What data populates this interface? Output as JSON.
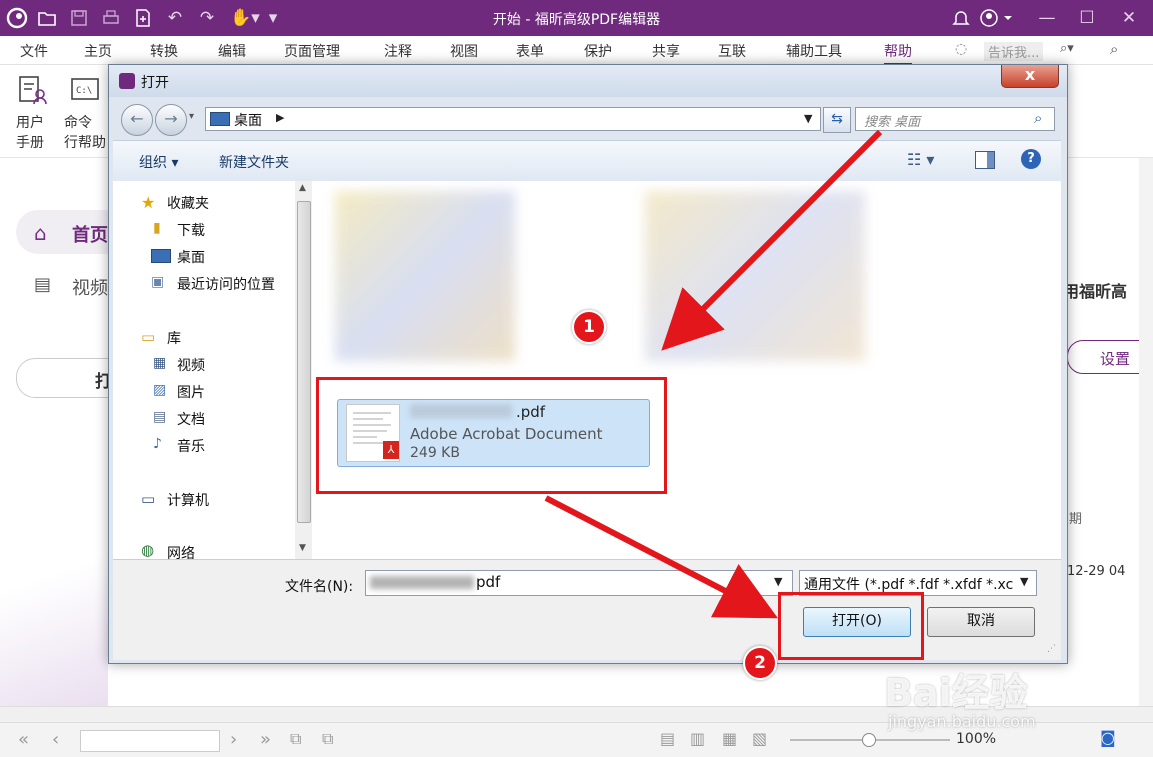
{
  "app": {
    "title": "开始 - 福昕高级PDF编辑器",
    "menus": [
      "文件",
      "主页",
      "转换",
      "编辑",
      "页面管理",
      "注释",
      "视图",
      "表单",
      "保护",
      "共享",
      "互联",
      "辅助工具",
      "帮助"
    ],
    "active_menu": "帮助",
    "search_placeholder": "告诉我...",
    "ribbon": [
      {
        "label1": "用户",
        "label2": "手册",
        "icon": "user-manual-icon"
      },
      {
        "label1": "命令",
        "label2": "行帮助",
        "icon": "command-line-icon"
      }
    ],
    "left_nav": [
      {
        "label": "首页",
        "icon": "home-icon"
      },
      {
        "label": "视频",
        "icon": "video-icon"
      }
    ],
    "left_button_partial": "打",
    "right_partial": {
      "heading": "用福昕高",
      "settings": "设置",
      "date_col": "期",
      "date_value": "12-29 04"
    },
    "zoom": "100%"
  },
  "dialog": {
    "title": "打开",
    "close": "x",
    "address": "桌面",
    "search_placeholder": "搜索 桌面",
    "organize": "组织",
    "new_folder": "新建文件夹",
    "favorites": {
      "label": "收藏夹",
      "items": [
        "下载",
        "桌面",
        "最近访问的位置"
      ]
    },
    "libraries": {
      "label": "库",
      "items": [
        "视频",
        "图片",
        "文档",
        "音乐"
      ]
    },
    "computer": "计算机",
    "network": "网络",
    "file": {
      "name": ".pdf",
      "type": "Adobe Acrobat Document",
      "size": "249 KB"
    },
    "filename_label": "文件名(N):",
    "filename_value": "pdf",
    "filetype": "通用文件 (*.pdf *.fdf *.xfdf *.xc",
    "open_button": "打开(O)",
    "cancel_button": "取消"
  },
  "annotations": {
    "step1": "1",
    "step2": "2"
  },
  "watermark": {
    "text": "Bai经验",
    "url": "jingyan.baidu.com"
  },
  "colors": {
    "brand": "#6f2a7d",
    "annotation_red": "#e3161b",
    "selection_blue": "#cde3f8"
  }
}
